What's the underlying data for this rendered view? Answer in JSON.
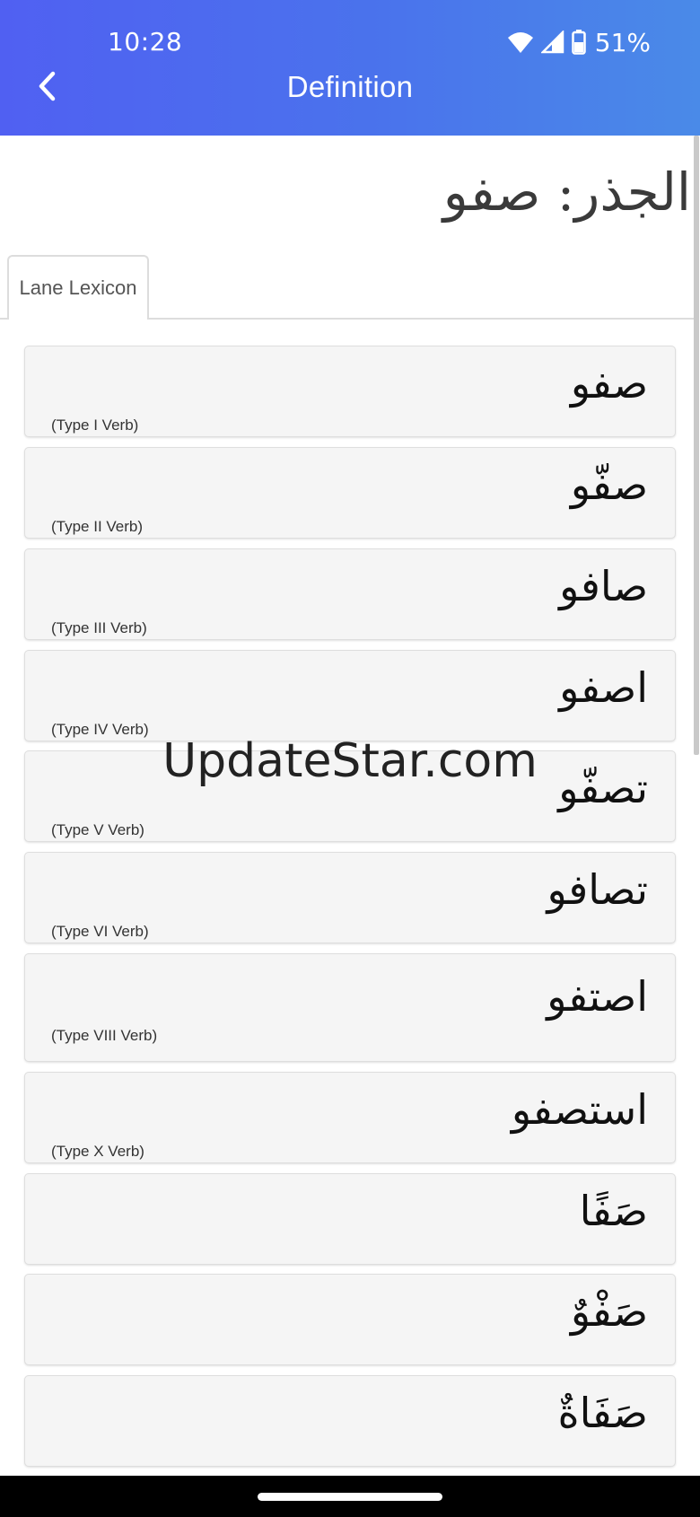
{
  "status_bar": {
    "time": "10:28",
    "battery_percent": "51%",
    "icons": [
      "wifi-icon",
      "cell-signal-icon",
      "battery-icon"
    ]
  },
  "header": {
    "title": "Definition",
    "back_icon": "chevron-left-icon",
    "gradient_colors": [
      "#5060f2",
      "#4a8ae8"
    ]
  },
  "root_heading": "الجذر: صفو",
  "tabs": [
    {
      "label": "Lane Lexicon",
      "selected": true
    }
  ],
  "entries": [
    {
      "word": "صفو",
      "type": "(Type I Verb)"
    },
    {
      "word": "صفّو",
      "type": "(Type II Verb)"
    },
    {
      "word": "صافو",
      "type": "(Type III Verb)"
    },
    {
      "word": "اصفو",
      "type": "(Type IV Verb)"
    },
    {
      "word": "تصفّو",
      "type": "(Type V Verb)"
    },
    {
      "word": "تصافو",
      "type": "(Type VI Verb)"
    },
    {
      "word": "اصتفو",
      "type": "(Type VIII Verb)"
    },
    {
      "word": "استصفو",
      "type": "(Type X Verb)"
    },
    {
      "word": "صَفًا",
      "type": ""
    },
    {
      "word": "صَفْوٌ",
      "type": ""
    },
    {
      "word": "صَفَاةٌ",
      "type": ""
    }
  ],
  "watermark": "UpdateStar.com"
}
